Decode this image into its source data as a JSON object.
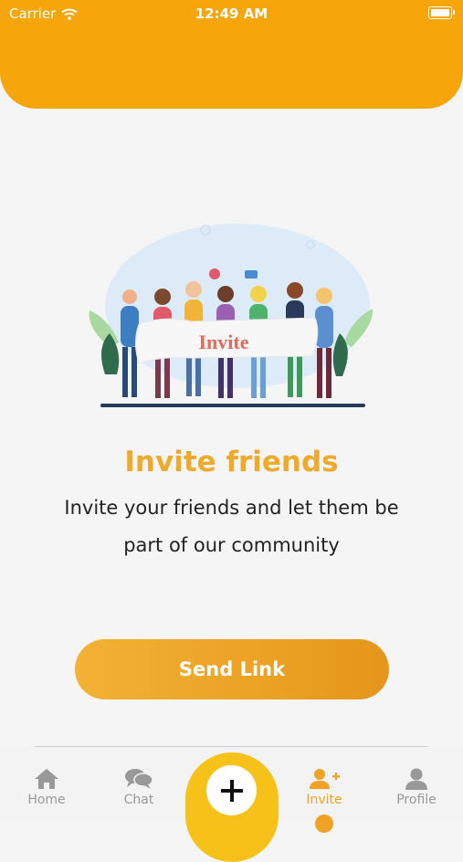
{
  "status_bar": {
    "carrier": "Carrier",
    "time": "12:49 AM"
  },
  "illustration": {
    "banner_text": "Invite"
  },
  "content": {
    "title": "Invite friends",
    "subtitle_line1": "Invite your friends and let them be",
    "subtitle_line2": "part of our community"
  },
  "actions": {
    "send_link_label": "Send Link"
  },
  "tabbar": {
    "home": "Home",
    "chat": "Chat",
    "invite": "Invite",
    "profile": "Profile",
    "active_tab": "Invite"
  },
  "colors": {
    "primary": "#f6a50a",
    "title": "#eeaa2c",
    "fab": "#f6c21a",
    "inactive_tab": "#999999"
  }
}
